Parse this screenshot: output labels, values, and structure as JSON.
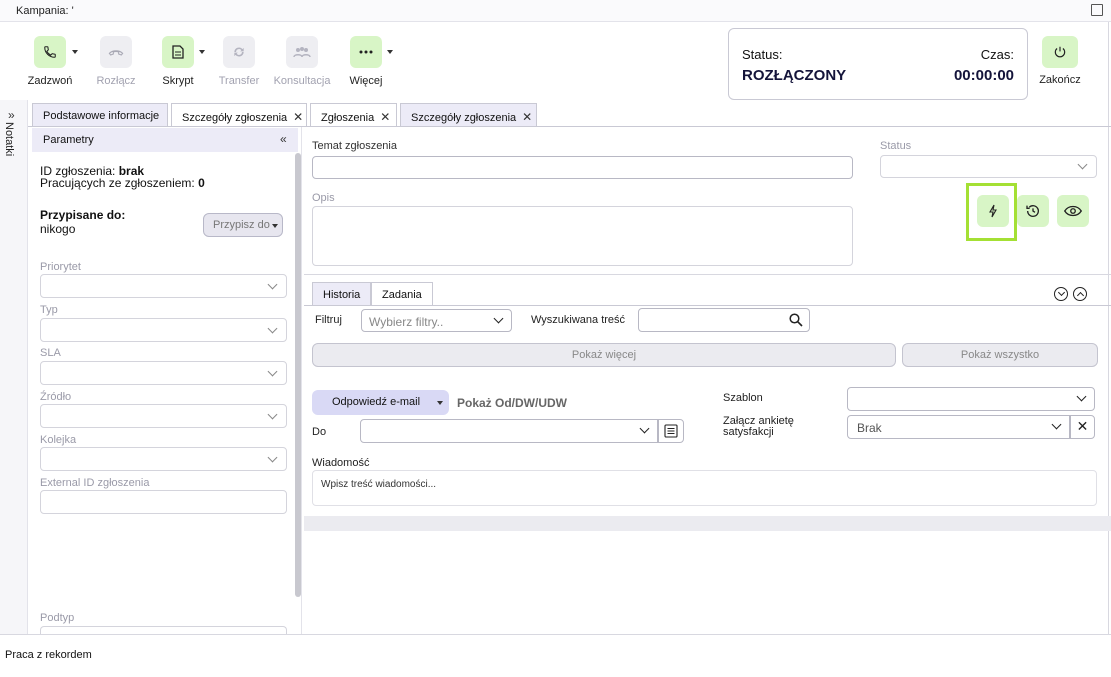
{
  "header": {
    "campaign_label": "Kampania: '"
  },
  "toolbar": {
    "call": "Zadzwoń",
    "disconnect": "Rozłącz",
    "script": "Skrypt",
    "transfer": "Transfer",
    "consultation": "Konsultacja",
    "more": "Więcej",
    "end": "Zakończ"
  },
  "status": {
    "label": "Status:",
    "value": "ROZŁĄCZONY",
    "time_label": "Czas:",
    "time_value": "00:00:00"
  },
  "side": {
    "notes": "Notatki"
  },
  "tabs": [
    {
      "label": "Podstawowe informacje"
    },
    {
      "label": "Szczegóły zgłoszenia"
    },
    {
      "label": "Zgłoszenia"
    },
    {
      "label": "Szczegóły zgłoszenia"
    }
  ],
  "params": {
    "title": "Parametry",
    "id_label": "ID zgłoszenia:",
    "id_value": "brak",
    "workers_label": "Pracujących ze zgłoszeniem:",
    "workers_value": "0",
    "assigned_label": "Przypisane do:",
    "assigned_value": "nikogo",
    "assign_button": "Przypisz do",
    "fields": [
      "Priorytet",
      "Typ",
      "SLA",
      "Źródło",
      "Kolejka",
      "External ID zgłoszenia",
      "Podtyp"
    ]
  },
  "form": {
    "subject_label": "Temat zgłoszenia",
    "status_label": "Status",
    "description_label": "Opis"
  },
  "subtabs": {
    "history": "Historia",
    "tasks": "Zadania"
  },
  "filters": {
    "filter_label": "Filtruj",
    "filter_placeholder": "Wybierz filtry..",
    "search_label": "Wyszukiwana treść",
    "show_more": "Pokaż więcej",
    "show_all": "Pokaż wszystko"
  },
  "reply": {
    "button": "Odpowiedź e-mail",
    "show_from": "Pokaż Od/DW/UDW",
    "to_label": "Do",
    "template_label": "Szablon",
    "attach_label": "Załącz ankietę satysfakcji",
    "attach_value": "Brak",
    "message_label": "Wiadomość",
    "message_placeholder": "Wpisz treść wiadomości..."
  },
  "footer": {
    "label": "Praca z rekordem"
  },
  "colors": {
    "accent_green": "#d8f5c6",
    "highlight": "#a4e034",
    "tab_alt": "#ecebf7"
  }
}
